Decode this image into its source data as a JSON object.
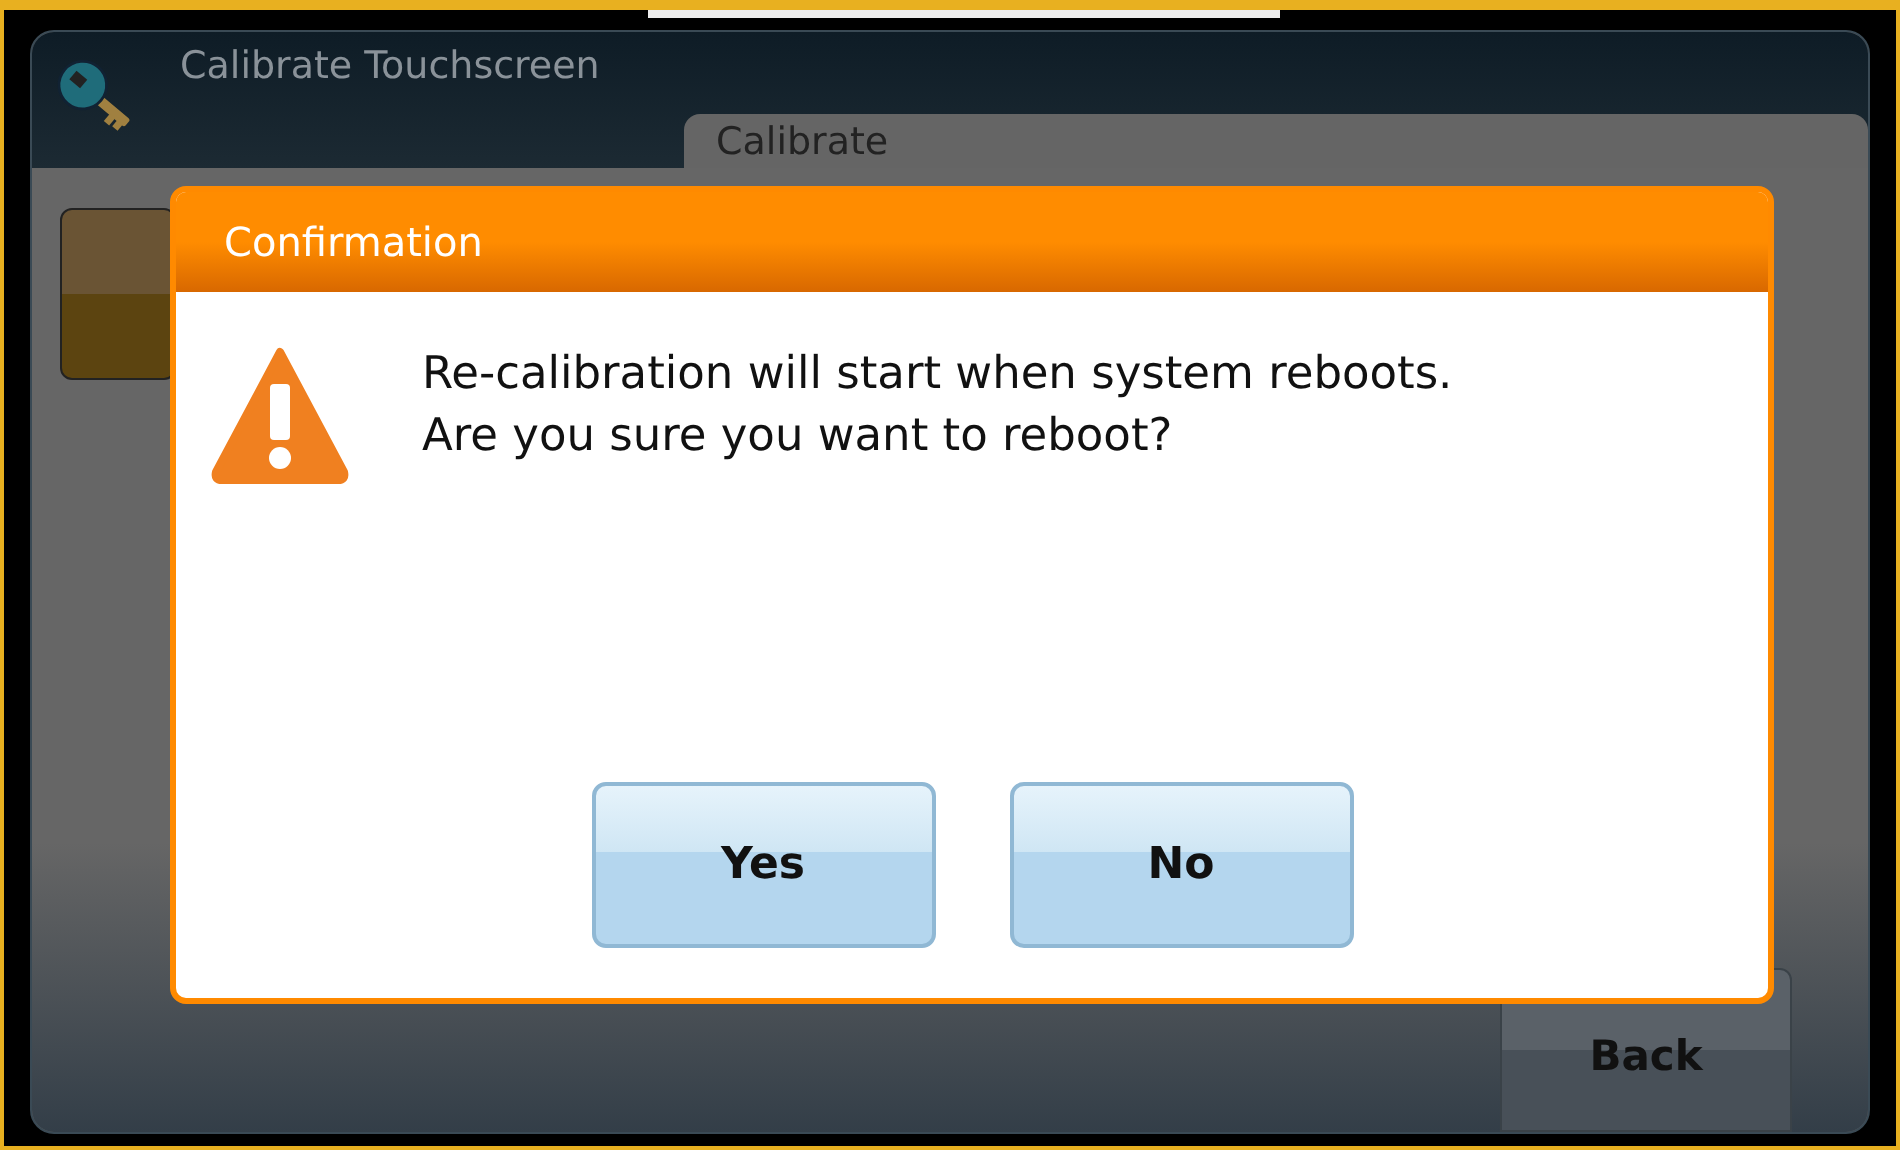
{
  "window": {
    "title": "Calibrate Touchscreen"
  },
  "tabs": [
    {
      "label": "Calibrate",
      "selected": true
    }
  ],
  "back_button": "Back",
  "dialog": {
    "title": "Confirmation",
    "message": "Re-calibration will start when system reboots. Are you sure you want to reboot?",
    "buttons": [
      "Yes",
      "No"
    ]
  }
}
